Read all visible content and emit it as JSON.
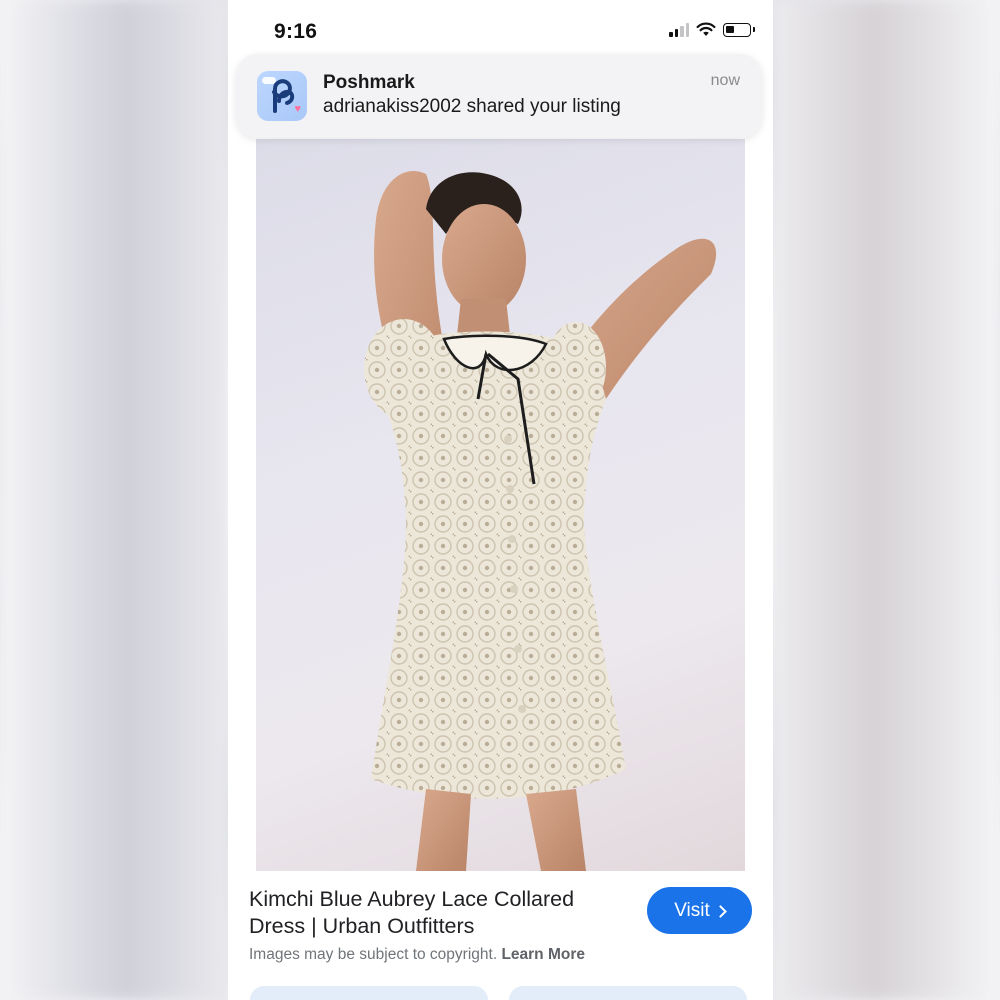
{
  "status_bar": {
    "time": "9:16"
  },
  "notification": {
    "app_name": "Poshmark",
    "message": "adrianakiss2002 shared your listing",
    "timestamp": "now",
    "icon": "poshmark-app-icon"
  },
  "result": {
    "title": "Kimchi Blue Aubrey Lace Collared Dress | Urban Outfitters",
    "copyright_notice": "Images may be subject to copyright.",
    "learn_more": "Learn More",
    "visit_label": "Visit"
  },
  "colors": {
    "accent": "#1a73e8",
    "notification_bg": "#f3f3f5"
  }
}
